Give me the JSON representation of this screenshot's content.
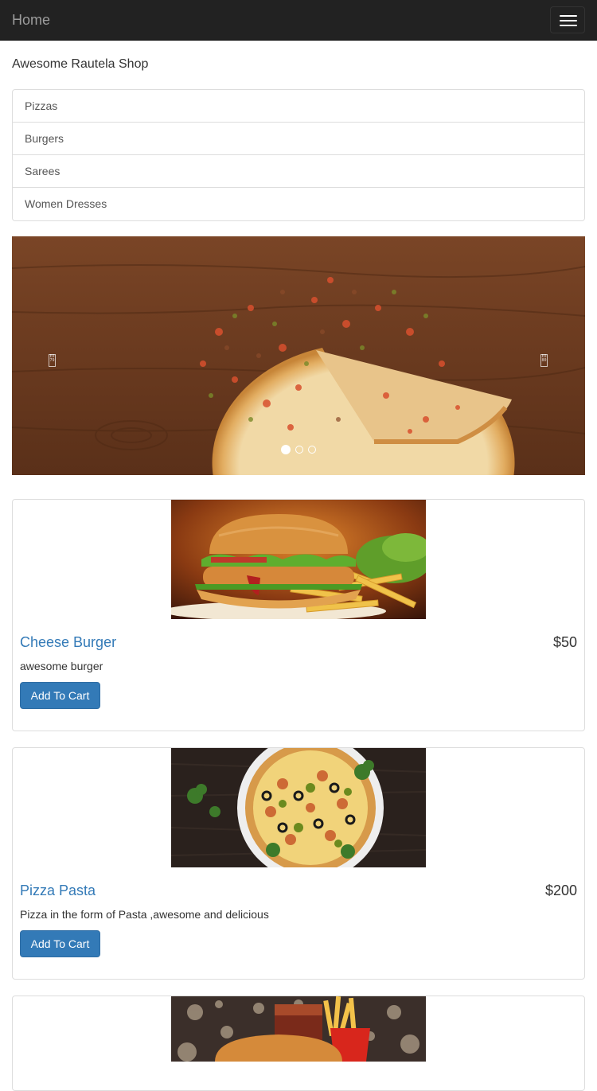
{
  "navbar": {
    "brand": "Home",
    "menu_icon": "hamburger-menu-icon"
  },
  "shop_title": "Awesome Rautela Shop",
  "categories": [
    "Pizzas",
    "Burgers",
    "Sarees",
    "Women Dresses"
  ],
  "carousel": {
    "slide_count": 3,
    "active_index": 0,
    "prev_icon": "carousel-prev-icon",
    "next_icon": "carousel-next-icon",
    "prev_glyph": "E0 79",
    "next_glyph": "E0 80"
  },
  "products": [
    {
      "name": "Cheese Burger",
      "price": "$50",
      "description": "awesome burger",
      "button": "Add To Cart"
    },
    {
      "name": "Pizza Pasta",
      "price": "$200",
      "description": "Pizza in the form of Pasta ,awesome and delicious",
      "button": "Add To Cart"
    },
    {
      "name": "",
      "price": "",
      "description": "",
      "button": ""
    }
  ],
  "colors": {
    "navbar_bg": "#222222",
    "brand_text": "#9d9d9d",
    "link": "#337ab7",
    "primary_button": "#337ab7",
    "border": "#dddddd"
  }
}
